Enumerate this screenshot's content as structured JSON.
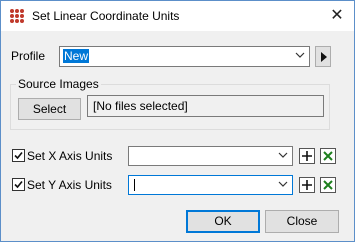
{
  "window": {
    "title": "Set Linear Coordinate Units"
  },
  "profile": {
    "label": "Profile",
    "value": "New"
  },
  "source_images": {
    "group_title": "Source Images",
    "select_label": "Select",
    "files_text": "[No files selected]"
  },
  "x_axis": {
    "label": "Set X Axis Units",
    "checked": true,
    "value": ""
  },
  "y_axis": {
    "label": "Set Y Axis Units",
    "checked": true,
    "value": ""
  },
  "buttons": {
    "ok": "OK",
    "close": "Close"
  },
  "colors": {
    "selection": "#0078d7",
    "border_accent": "#5c8fc9",
    "delete_icon": "#1e7f1e"
  },
  "icons": [
    "app-icon",
    "close-icon",
    "chevron-down-icon",
    "arrow-right-icon",
    "checkmark-icon",
    "plus-icon",
    "delete-icon"
  ]
}
